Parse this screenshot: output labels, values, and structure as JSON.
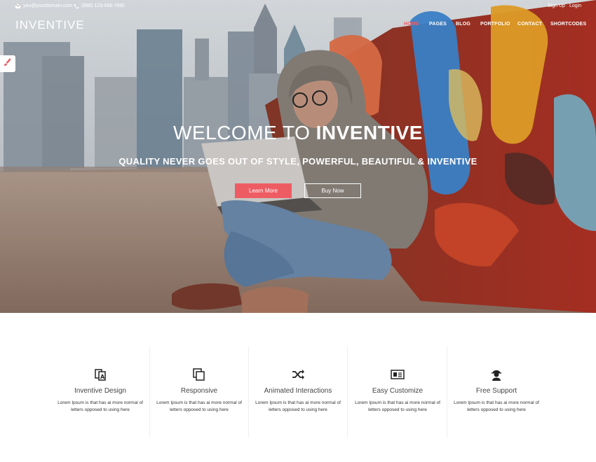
{
  "topbar": {
    "email": "you@yourdomain.com",
    "phone": "(888) 123-456-7890",
    "signup": "Sign Up",
    "login": "Login"
  },
  "brand": {
    "logo": "INVENTIVE"
  },
  "nav": {
    "items": [
      {
        "label": "HOME",
        "active": true
      },
      {
        "label": "PAGES",
        "active": false
      },
      {
        "label": "BLOG",
        "active": false
      },
      {
        "label": "PORTFOLIO",
        "active": false
      },
      {
        "label": "CONTACT",
        "active": false
      },
      {
        "label": "SHORTCODES",
        "active": false
      }
    ]
  },
  "side_tool": {
    "icon": "paint-brush-icon"
  },
  "hero": {
    "title_light": "WELCOME TO",
    "title_bold": "INVENTIVE",
    "subtitle": "QUALITY NEVER GOES OUT OF STYLE, POWERFUL, BEAUTIFUL & INVENTIVE",
    "primary_button": "Learn More",
    "secondary_button": "Buy Now"
  },
  "features": [
    {
      "icon": "design-icon",
      "title": "Inventive Design",
      "desc": "Lorem Ipsum is that has ai more normal of letters opposed to using here"
    },
    {
      "icon": "responsive-icon",
      "title": "Responsive",
      "desc": "Lorem Ipsum is that has ai more normal of letters opposed to using here"
    },
    {
      "icon": "shuffle-icon",
      "title": "Animated Interactions",
      "desc": "Lorem Ipsum is that has ai more normal of letters opposed to using here"
    },
    {
      "icon": "newspaper-icon",
      "title": "Easy Customize",
      "desc": "Lorem Ipsum is that has ai more normal of letters opposed to using here"
    },
    {
      "icon": "support-icon",
      "title": "Free Support",
      "desc": "Lorem Ipsum is that has ai more normal of letters opposed to using here"
    }
  ],
  "colors": {
    "accent": "#ee5c63",
    "text_dark": "#444444",
    "white": "#ffffff"
  }
}
